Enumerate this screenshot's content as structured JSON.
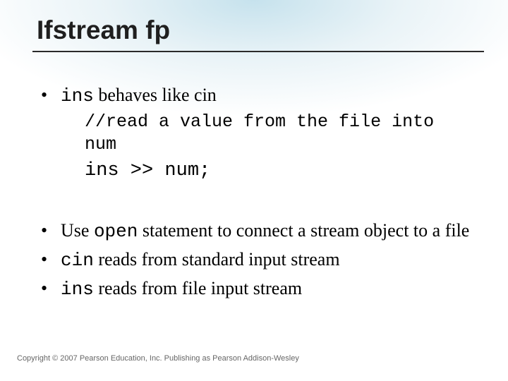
{
  "title": "Ifstream fp",
  "bullets": {
    "b1": {
      "pre": "ins",
      "post": " behaves like cin"
    },
    "comment": "//read a value from the file into num",
    "codeline": "ins >> num;",
    "b2": {
      "t1": "Use ",
      "c1": "open",
      "t2": " statement to connect a stream object to a file"
    },
    "b3": {
      "c1": "cin",
      "t1": " reads from standard input stream"
    },
    "b4": {
      "c1": "ins",
      "t1": " reads from file input stream"
    }
  },
  "copyright": "Copyright © 2007 Pearson Education, Inc. Publishing as Pearson Addison-Wesley"
}
